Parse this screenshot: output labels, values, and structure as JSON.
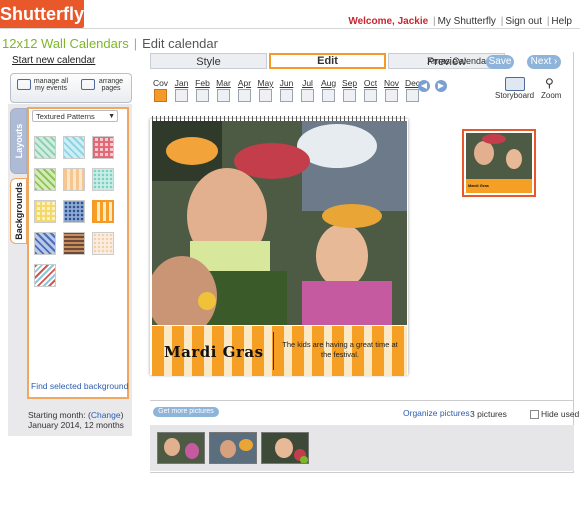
{
  "header": {
    "logo": "Shutterfly",
    "welcome": "Welcome, Jackie",
    "links": [
      "My Shutterfly",
      "Sign out",
      "Help"
    ]
  },
  "page": {
    "product": "12x12 Wall Calendars",
    "crumb": "Edit calendar",
    "start_new": "Start new calendar"
  },
  "tabs": [
    {
      "label": "Style",
      "active": false
    },
    {
      "label": "Edit",
      "active": true
    },
    {
      "label": "Preview",
      "active": false
    }
  ],
  "calendar_name": "Xmas Calendar",
  "buttons": {
    "save": "Save",
    "next": "Next ›"
  },
  "toolbar": {
    "manage_events": "manage all\nmy events",
    "arrange_pages": "arrange\npages",
    "storyboard": "Storyboard",
    "zoom": "Zoom"
  },
  "months": [
    "Cov",
    "Jan",
    "Feb",
    "Mar",
    "Apr",
    "May",
    "Jun",
    "Jul",
    "Aug",
    "Sep",
    "Oct",
    "Nov",
    "Dec"
  ],
  "current_month": "Cov",
  "left_panel": {
    "tab_layouts": "Layouts",
    "tab_backgrounds": "Backgrounds",
    "category": "Textured Patterns",
    "find_selected": "Find selected background",
    "starting_label": "Starting month: (",
    "change_link": "Change",
    "starting_close": ")",
    "starting_value": "January 2014, 12 months"
  },
  "swatches": [
    {
      "c1": "#8ed0b2",
      "c2": "#cfeee0",
      "style": "diag"
    },
    {
      "c1": "#8fd4e2",
      "c2": "#cdeef5",
      "style": "diag"
    },
    {
      "c1": "#e06a78",
      "c2": "#f6c9cf",
      "style": "check"
    },
    {
      "c1": "#8cc65a",
      "c2": "#d6ecb8",
      "style": "diag"
    },
    {
      "c1": "#f5c690",
      "c2": "#fbe6c8",
      "style": "vstripe"
    },
    {
      "c1": "#7ccfc0",
      "c2": "#c8eee6",
      "style": "dots"
    },
    {
      "c1": "#f3d96a",
      "c2": "#fbf1c4",
      "style": "check"
    },
    {
      "c1": "#2d4f86",
      "c2": "#8eaad6",
      "style": "dots"
    },
    {
      "c1": "#f5a024",
      "c2": "#fbe8c4",
      "style": "vstripe"
    },
    {
      "c1": "#4e6fb8",
      "c2": "#b9c9ea",
      "style": "diag"
    },
    {
      "c1": "#6b4a3a",
      "c2": "#c88d5c",
      "style": "hstripe"
    },
    {
      "c1": "#f1d0b0",
      "c2": "#fbeee0",
      "style": "dots"
    },
    {
      "c1": "#d6544e",
      "c2": "#8ec6d6",
      "style": "zigzag"
    }
  ],
  "selected_swatch": 8,
  "page_banner": {
    "title": "Mardi Gras",
    "caption": "The kids are having a great time at the festival."
  },
  "thumb_banner": "Mardi Gras",
  "bottom": {
    "get_more": "Get more pictures",
    "organize": "Organize pictures",
    "count": "3 pictures",
    "hide_used": "Hide used"
  }
}
